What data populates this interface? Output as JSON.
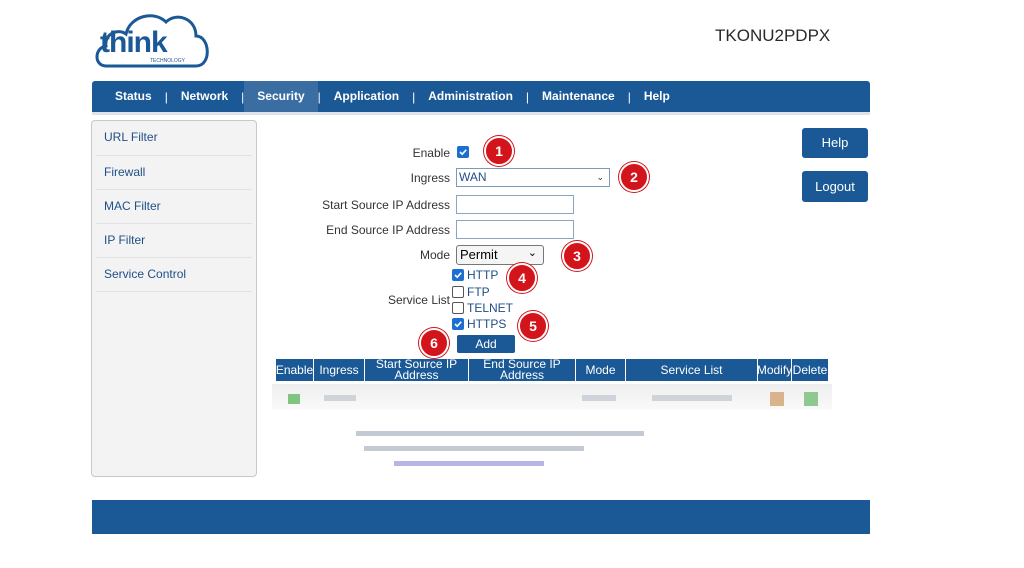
{
  "logo": {
    "text": "think",
    "sub": "TECHNOLOGY"
  },
  "device_name": "TKONU2PDPX",
  "nav": {
    "items": [
      "Status",
      "Network",
      "Security",
      "Application",
      "Administration",
      "Maintenance",
      "Help"
    ],
    "active": "Security",
    "separator": "|"
  },
  "sidebar": {
    "items": [
      "URL Filter",
      "Firewall",
      "MAC Filter",
      "IP Filter",
      "Service Control"
    ]
  },
  "form": {
    "enable_label": "Enable",
    "enable_checked": true,
    "ingress_label": "Ingress",
    "ingress_value": "WAN",
    "start_ip_label": "Start Source IP Address",
    "start_ip_value": "",
    "end_ip_label": "End Source IP Address",
    "end_ip_value": "",
    "mode_label": "Mode",
    "mode_value": "Permit",
    "service_list_label": "Service List",
    "services": [
      {
        "label": "HTTP",
        "checked": true
      },
      {
        "label": "FTP",
        "checked": false
      },
      {
        "label": "TELNET",
        "checked": false
      },
      {
        "label": "HTTPS",
        "checked": true
      }
    ],
    "add_label": "Add"
  },
  "right_buttons": {
    "help": "Help",
    "logout": "Logout"
  },
  "markers": [
    "1",
    "2",
    "3",
    "4",
    "5",
    "6"
  ],
  "table": {
    "headers": [
      "Enable",
      "Ingress",
      "Start Source IP Address",
      "End Source IP Address",
      "Mode",
      "Service List",
      "Modify",
      "Delete"
    ]
  },
  "colors": {
    "nav_bg": "#1a5896",
    "marker_red": "#d3141b",
    "link_blue": "#1f4f86"
  }
}
